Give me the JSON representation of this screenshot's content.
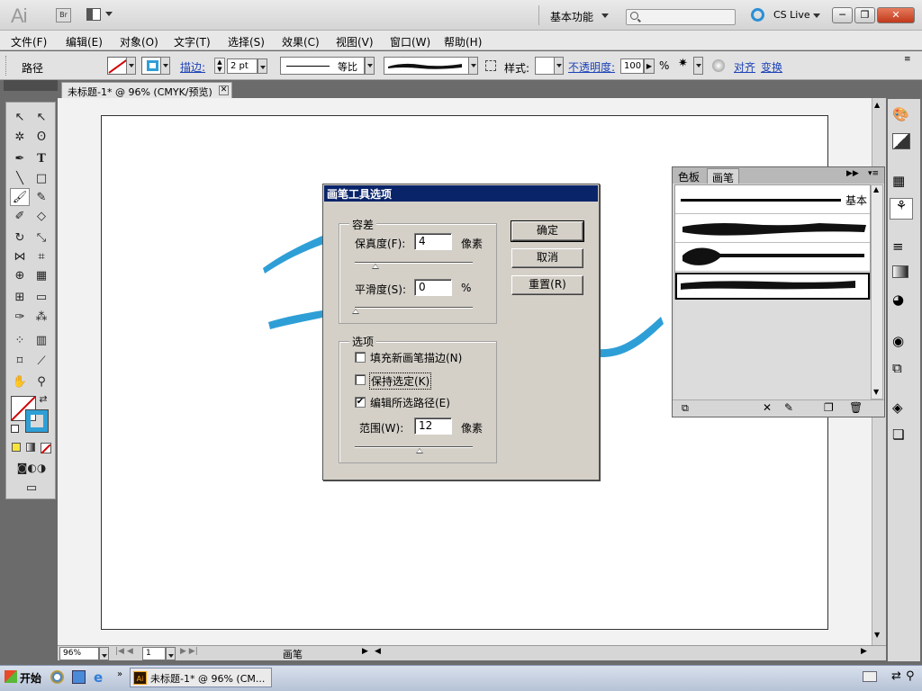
{
  "app": {
    "logo": "Ai",
    "bridge": "Br",
    "workspace": "基本功能",
    "cslive": "CS Live"
  },
  "window_buttons": {
    "minimize": "─",
    "maximize": "❐",
    "close": "✕"
  },
  "menu": [
    "文件(F)",
    "编辑(E)",
    "对象(O)",
    "文字(T)",
    "选择(S)",
    "效果(C)",
    "视图(V)",
    "窗口(W)",
    "帮助(H)"
  ],
  "control": {
    "selection_label": "路径",
    "stroke_link": "描边:",
    "stroke_weight": "2 pt",
    "profile_label": "等比",
    "style_label": "样式:",
    "opacity_link": "不透明度:",
    "opacity_value": "100",
    "percent": "%",
    "align_link": "对齐",
    "transform_link": "变换"
  },
  "document": {
    "tab_title": "未标题-1* @ 96% (CMYK/预览)",
    "close": "✕"
  },
  "status": {
    "zoom": "96%",
    "page": "1",
    "tool": "画笔"
  },
  "dialog": {
    "title": "画笔工具选项",
    "tolerance_group": "容差",
    "fidelity_label": "保真度(F):",
    "fidelity_value": "4",
    "fidelity_unit": "像素",
    "smoothness_label": "平滑度(S):",
    "smoothness_value": "0",
    "smoothness_unit": "%",
    "options_group": "选项",
    "fill_new": {
      "label": "填充新画笔描边(N)",
      "checked": false
    },
    "keep_selected": {
      "label": "保持选定(K)",
      "checked": false
    },
    "edit_selected": {
      "label": "编辑所选路径(E)",
      "checked": true
    },
    "range_label": "范围(W):",
    "range_value": "12",
    "range_unit": "像素",
    "ok": "确定",
    "cancel": "取消",
    "reset": "重置(R)"
  },
  "brushes_panel": {
    "tabs": [
      "色板",
      "画笔"
    ],
    "active_tab": "画笔",
    "basic_label": "基本"
  },
  "taskbar": {
    "start": "开始",
    "task": "未标题-1* @ 96% (CM..."
  },
  "colors": {
    "stroke_blue": "#2e9fd6",
    "dialog_title_bg": "#0a246a",
    "panel_bg": "#d6d6d6"
  }
}
